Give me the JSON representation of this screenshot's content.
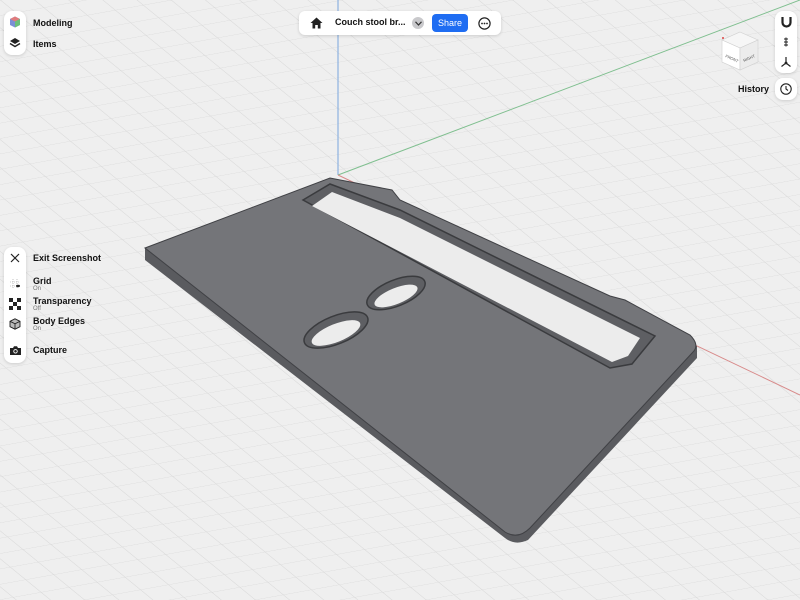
{
  "topbar": {
    "title": "Couch stool br...",
    "share_label": "Share"
  },
  "left_panel": {
    "modeling_label": "Modeling",
    "items_label": "Items"
  },
  "screenshot_panel": {
    "exit_label": "Exit Screenshot",
    "grid": {
      "label": "Grid",
      "state": "On"
    },
    "transparency": {
      "label": "Transparency",
      "state": "Off"
    },
    "body_edges": {
      "label": "Body Edges",
      "state": "On"
    },
    "capture_label": "Capture"
  },
  "right_panel": {
    "history_label": "History",
    "view_cube_faces": [
      "FRONT",
      "RIGHT"
    ]
  },
  "colors": {
    "accent": "#1f6df2",
    "background": "#efefef",
    "model": "#747579",
    "axis_x": "#d88a8a",
    "axis_y": "#7fbf8f",
    "axis_z": "#7aa6dd"
  },
  "icons": [
    "modeling-cube-icon",
    "layers-icon",
    "home-icon",
    "chevron-down-icon",
    "more-icon",
    "magnet-icon",
    "view-cube-icon",
    "clock-icon",
    "close-icon",
    "grid-icon",
    "transparency-icon",
    "body-edges-icon",
    "camera-icon"
  ]
}
